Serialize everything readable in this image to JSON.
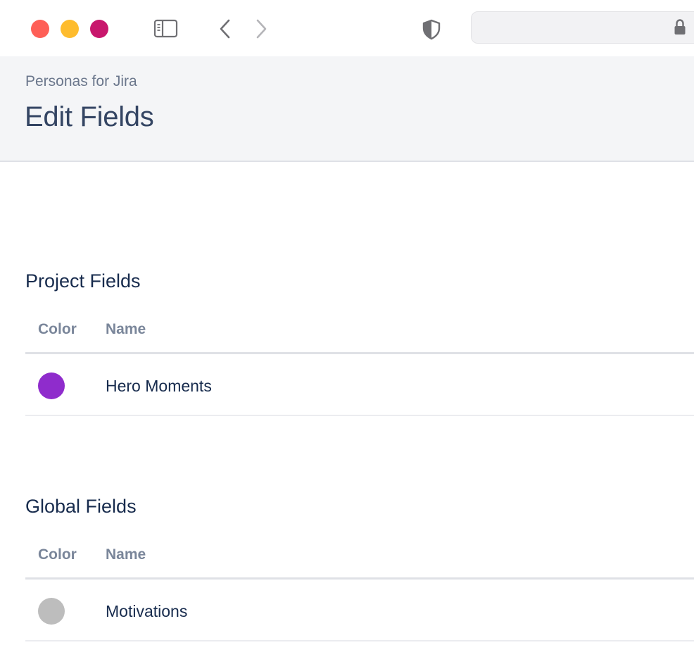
{
  "window": {
    "controls": [
      {
        "name": "close",
        "color": "#fe5f57"
      },
      {
        "name": "minimize",
        "color": "#febc2e"
      },
      {
        "name": "zoom",
        "color": "#c8176d"
      }
    ],
    "toolbar_icons": [
      "sidebar-toggle-icon",
      "back-arrow-icon",
      "forward-arrow-icon",
      "shield-icon",
      "lock-icon"
    ],
    "address_bar": {
      "value": ""
    }
  },
  "header": {
    "breadcrumb": "Personas for Jira",
    "title": "Edit Fields",
    "background": "#f4f5f7"
  },
  "sections": [
    {
      "heading": "Project Fields",
      "columns": {
        "color": "Color",
        "name": "Name"
      },
      "rows": [
        {
          "color": "#8f2ccc",
          "name": "Hero Moments"
        }
      ]
    },
    {
      "heading": "Global Fields",
      "columns": {
        "color": "Color",
        "name": "Name"
      },
      "rows": [
        {
          "color": "#bdbdbd",
          "name": "Motivations"
        }
      ]
    }
  ]
}
